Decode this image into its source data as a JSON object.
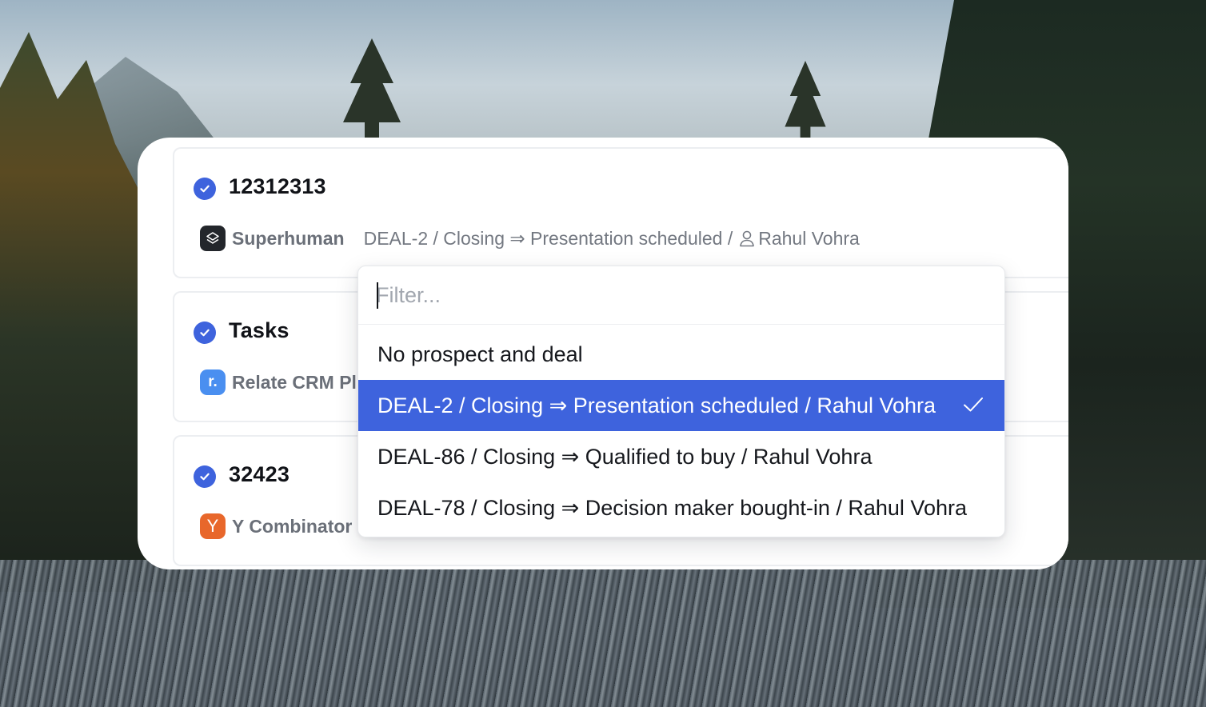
{
  "rows": [
    {
      "title": "12312313",
      "company": "Superhuman",
      "logo_letter": "",
      "deal": "DEAL-2 / Closing ⇒ Presentation scheduled /",
      "owner": "Rahul Vohra"
    },
    {
      "title": "Tasks",
      "company": "Relate CRM Pl",
      "logo_letter": "r."
    },
    {
      "title": "32423",
      "company": "Y Combinator",
      "logo_letter": "Y"
    }
  ],
  "dropdown": {
    "filter_placeholder": "Filter...",
    "filter_value": "",
    "options": [
      {
        "label": "No prospect and deal",
        "selected": false
      },
      {
        "label": "DEAL-2 / Closing ⇒ Presentation scheduled / Rahul Vohra",
        "selected": true
      },
      {
        "label": "DEAL-86 / Closing ⇒ Qualified to buy / Rahul Vohra",
        "selected": false
      },
      {
        "label": "DEAL-78 / Closing ⇒ Decision maker bought-in / Rahul Vohra",
        "selected": false
      }
    ]
  },
  "colors": {
    "accent": "#3e63dd",
    "check_circle": "#3e63dd",
    "relate_logo": "#4a8ff0",
    "yc_logo": "#e8672b",
    "superhuman_logo": "#23262b"
  },
  "icons": {
    "row_status": "check-circle-icon",
    "owner": "person-icon",
    "selected": "checkmark-icon"
  }
}
